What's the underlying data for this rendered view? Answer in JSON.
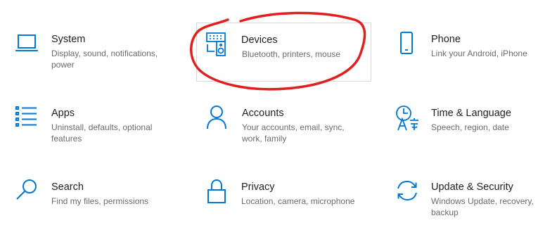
{
  "accent_color": "#0078d4",
  "annotation_color": "#e02020",
  "tiles": [
    {
      "key": "system",
      "icon": "laptop-icon",
      "title": "System",
      "description": "Display, sound, notifications, power"
    },
    {
      "key": "devices",
      "icon": "keyboard-speaker-icon",
      "title": "Devices",
      "description": "Bluetooth, printers, mouse",
      "highlighted": true
    },
    {
      "key": "phone",
      "icon": "phone-icon",
      "title": "Phone",
      "description": "Link your Android, iPhone"
    },
    {
      "key": "apps",
      "icon": "list-icon",
      "title": "Apps",
      "description": "Uninstall, defaults, optional features"
    },
    {
      "key": "accounts",
      "icon": "person-icon",
      "title": "Accounts",
      "description": "Your accounts, email, sync, work, family"
    },
    {
      "key": "time-language",
      "icon": "clock-language-icon",
      "title": "Time & Language",
      "description": "Speech, region, date"
    },
    {
      "key": "search",
      "icon": "magnifier-icon",
      "title": "Search",
      "description": "Find my files, permissions"
    },
    {
      "key": "privacy",
      "icon": "padlock-icon",
      "title": "Privacy",
      "description": "Location, camera, microphone"
    },
    {
      "key": "update-security",
      "icon": "sync-arrows-icon",
      "title": "Update & Security",
      "description": "Windows Update, recovery, backup"
    }
  ]
}
